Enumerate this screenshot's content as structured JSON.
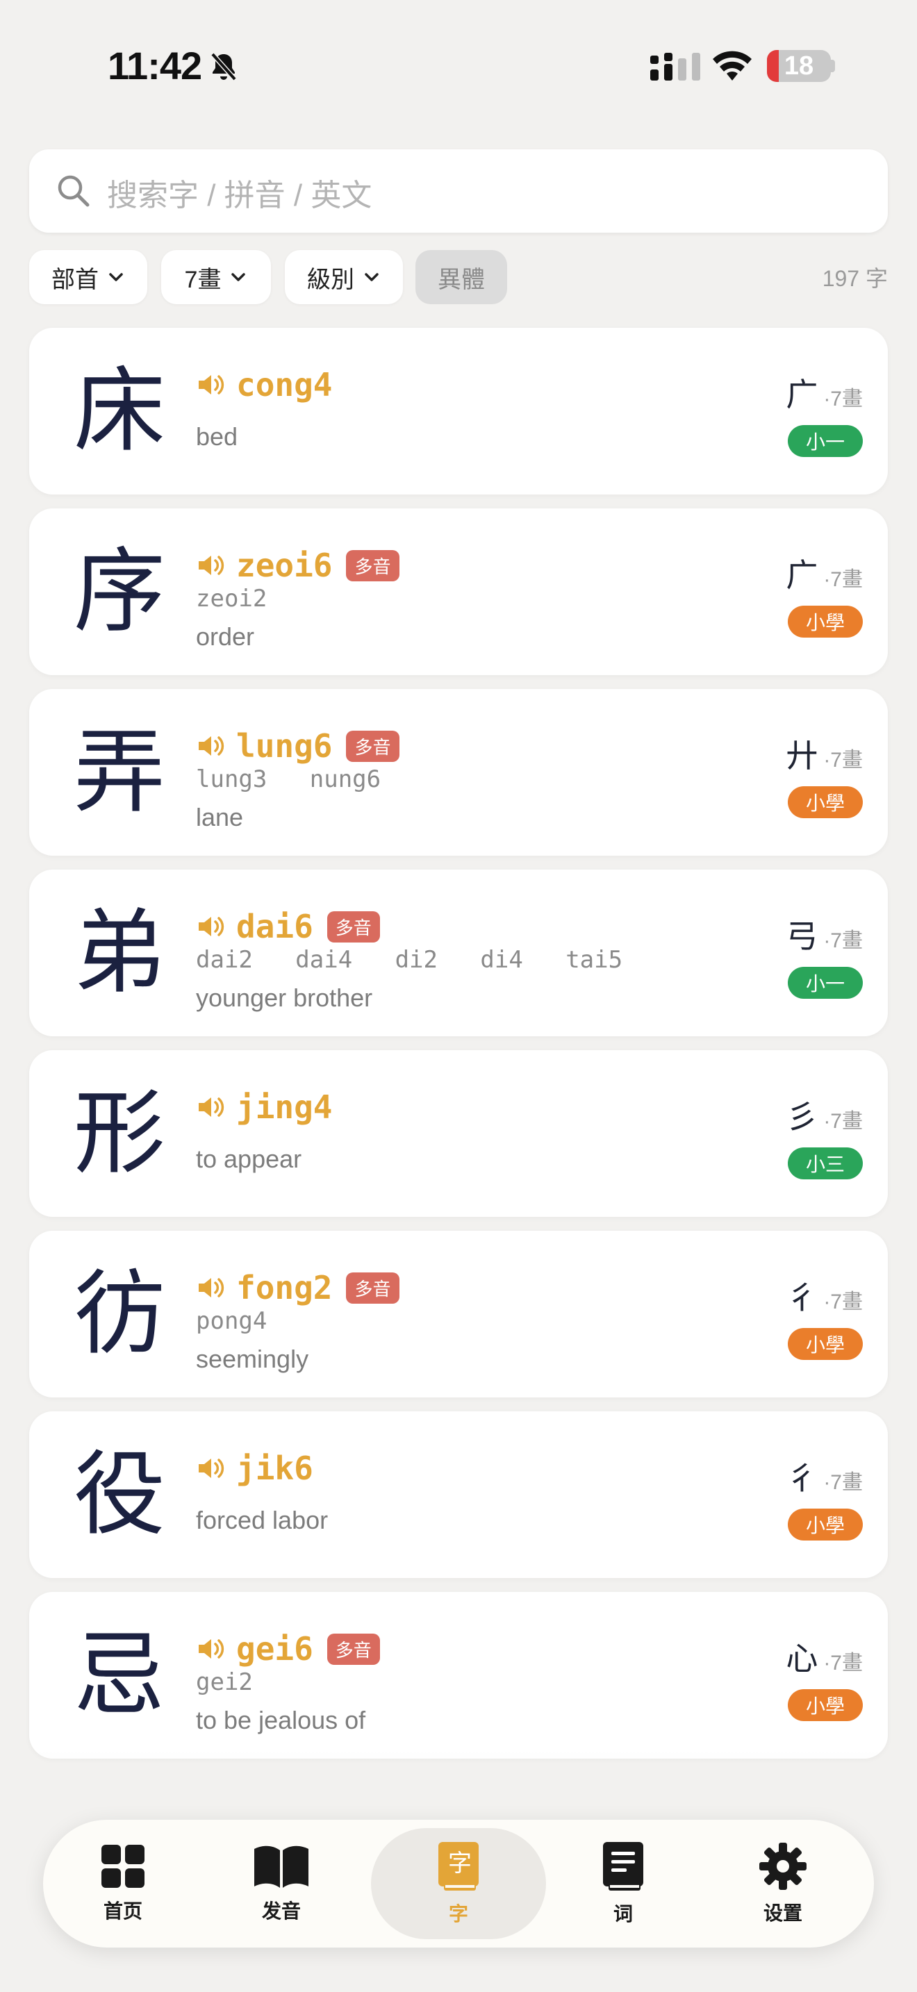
{
  "status": {
    "time": "11:42",
    "battery": "18",
    "battery_level": 0.18
  },
  "search": {
    "placeholder": "搜索字 / 拼音 / 英文"
  },
  "filters": {
    "radical": "部首",
    "strokes": "7畫",
    "level": "級別",
    "variant": "異體",
    "count": "197 字"
  },
  "characters": [
    {
      "char": "床",
      "jyutping": "cong4",
      "polyphonic": "",
      "alternates": "",
      "meaning": "bed",
      "radical": "广",
      "strokes": "·7畫",
      "grade": "小一",
      "grade_color": "#2aa55a"
    },
    {
      "char": "序",
      "jyutping": "zeoi6",
      "polyphonic": "多音",
      "alternates": "zeoi2",
      "meaning": "order",
      "radical": "广",
      "strokes": "·7畫",
      "grade": "小學",
      "grade_color": "#ea7e2b"
    },
    {
      "char": "弄",
      "jyutping": "lung6",
      "polyphonic": "多音",
      "alternates": "lung3   nung6",
      "meaning": "lane",
      "radical": "廾",
      "strokes": "·7畫",
      "grade": "小學",
      "grade_color": "#ea7e2b"
    },
    {
      "char": "弟",
      "jyutping": "dai6",
      "polyphonic": "多音",
      "alternates": "dai2   dai4   di2   di4   tai5",
      "meaning": "younger brother",
      "radical": "弓",
      "strokes": "·7畫",
      "grade": "小一",
      "grade_color": "#2aa55a"
    },
    {
      "char": "形",
      "jyutping": "jing4",
      "polyphonic": "",
      "alternates": "",
      "meaning": "to appear",
      "radical": "彡",
      "strokes": "·7畫",
      "grade": "小三",
      "grade_color": "#2aa55a"
    },
    {
      "char": "彷",
      "jyutping": "fong2",
      "polyphonic": "多音",
      "alternates": "pong4",
      "meaning": "seemingly",
      "radical": "彳",
      "strokes": "·7畫",
      "grade": "小學",
      "grade_color": "#ea7e2b"
    },
    {
      "char": "役",
      "jyutping": "jik6",
      "polyphonic": "",
      "alternates": "",
      "meaning": "forced labor",
      "radical": "彳",
      "strokes": "·7畫",
      "grade": "小學",
      "grade_color": "#ea7e2b"
    },
    {
      "char": "忌",
      "jyutping": "gei6",
      "polyphonic": "多音",
      "alternates": "gei2",
      "meaning": "to be jealous of",
      "radical": "心",
      "strokes": "·7畫",
      "grade": "小學",
      "grade_color": "#ea7e2b"
    }
  ],
  "tabs": [
    {
      "label": "首页",
      "icon": "grid-icon"
    },
    {
      "label": "发音",
      "icon": "open-book-icon"
    },
    {
      "label": "字",
      "icon": "character-book-icon",
      "active": true,
      "glyph": "字"
    },
    {
      "label": "词",
      "icon": "document-book-icon"
    },
    {
      "label": "设置",
      "icon": "gear-icon"
    }
  ],
  "colors": {
    "accent": "#e3a537",
    "polyphonic": "#d96b5e",
    "grade_green": "#2aa55a",
    "grade_orange": "#ea7e2b"
  }
}
